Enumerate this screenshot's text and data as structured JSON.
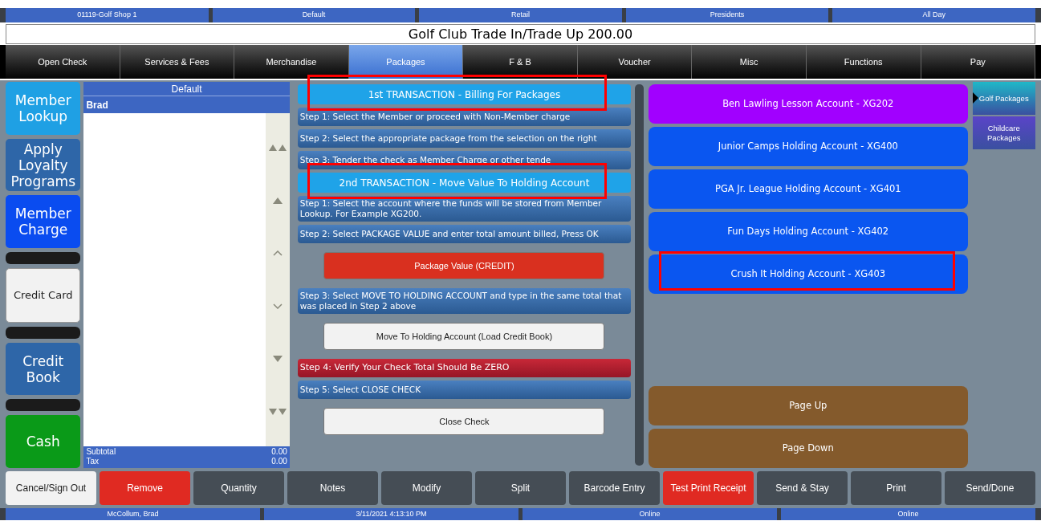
{
  "header_fields": [
    "01119-Golf Shop 1",
    "Default",
    "Retail",
    "Presidents",
    "All Day"
  ],
  "title": "Golf Club Trade In/Trade Up 200.00",
  "tabs": [
    {
      "label": "Open Check",
      "selected": false
    },
    {
      "label": "Services & Fees",
      "selected": false
    },
    {
      "label": "Merchandise",
      "selected": false
    },
    {
      "label": "Packages",
      "selected": true
    },
    {
      "label": "F & B",
      "selected": false
    },
    {
      "label": "Voucher",
      "selected": false
    },
    {
      "label": "Misc",
      "selected": false
    },
    {
      "label": "Functions",
      "selected": false
    },
    {
      "label": "Pay",
      "selected": false
    }
  ],
  "tender_buttons": [
    {
      "kind": "button",
      "label": "Member Lookup",
      "color": "#1fa0e4"
    },
    {
      "kind": "button",
      "label": "Apply Loyalty Programs",
      "color": "#2e66a8"
    },
    {
      "kind": "button",
      "label": "Member Charge",
      "color": "#0a4cf0"
    },
    {
      "kind": "blank"
    },
    {
      "kind": "button",
      "label": "Credit Card",
      "color": "#f2f2f2"
    },
    {
      "kind": "blank"
    },
    {
      "kind": "button",
      "label": "Credit Book",
      "color": "#2e66a8"
    },
    {
      "kind": "blank"
    },
    {
      "kind": "button",
      "label": "Cash",
      "color": "#0a9a18"
    }
  ],
  "check": {
    "header": "Default",
    "member": "Brad",
    "subtotal_label": "Subtotal",
    "subtotal": "0.00",
    "tax_label": "Tax",
    "tax": "0.00"
  },
  "instructions": [
    {
      "kind": "heading",
      "text": "1st TRANSACTION - Billing For Packages",
      "annotated": true
    },
    {
      "kind": "step",
      "text": "Step 1:  Select the Member or proceed with Non-Member charge"
    },
    {
      "kind": "step",
      "text": "Step 2:  Select the appropriate package from the selection on the right"
    },
    {
      "kind": "step",
      "text": "Step 3:  Tender the check as Member Charge or other tende"
    },
    {
      "kind": "heading",
      "text": "2nd TRANSACTION - Move Value To Holding Account",
      "annotated": true
    },
    {
      "kind": "step",
      "text": "Step 1:  Select the account where the funds will be stored from Member Lookup. For Example XG200."
    },
    {
      "kind": "step",
      "text": "Step 2:  Select PACKAGE VALUE and enter total amount billed, Press OK"
    },
    {
      "kind": "button",
      "text": "Package Value (CREDIT)",
      "color": "#d9301f"
    },
    {
      "kind": "step",
      "text": "Step 3:  Select MOVE TO HOLDING ACCOUNT and type in the same total that was placed in Step 2 above"
    },
    {
      "kind": "button",
      "text": "Move To Holding Account (Load Credit Book)",
      "color": "#f2f2f2"
    },
    {
      "kind": "alert",
      "text": "Step 4:  Verify Your Check Total Should Be ZERO"
    },
    {
      "kind": "step",
      "text": "Step 5:  Select CLOSE CHECK"
    },
    {
      "kind": "button",
      "text": "Close Check",
      "color": "#f2f2f2"
    }
  ],
  "accounts": [
    {
      "label": "Ben Lawling Lesson Account - XG202",
      "color": "#a100ff",
      "annotated": false
    },
    {
      "label": "Junior Camps Holding Account - XG400",
      "color": "#0a56f0",
      "annotated": false
    },
    {
      "label": "PGA Jr. League Holding Account - XG401",
      "color": "#0a56f0",
      "annotated": false
    },
    {
      "label": "Fun Days Holding Account - XG402",
      "color": "#0a56f0",
      "annotated": false
    },
    {
      "label": "Crush It Holding Account - XG403",
      "color": "#0a56f0",
      "annotated": true
    }
  ],
  "paging": [
    "Page Up",
    "Page Down"
  ],
  "categories": [
    {
      "label": "Golf Packages",
      "selected": true,
      "color": "#1fb8c8"
    },
    {
      "label": "Childcare Packages",
      "selected": false,
      "color": "#5a44c8"
    }
  ],
  "bottom_buttons": [
    {
      "label": "Cancel/Sign Out",
      "color": "#f2f2f2"
    },
    {
      "label": "Remove",
      "color": "#e02a22"
    },
    {
      "label": "Quantity",
      "color": "#454d55"
    },
    {
      "label": "Notes",
      "color": "#454d55"
    },
    {
      "label": "Modify",
      "color": "#454d55"
    },
    {
      "label": "Split",
      "color": "#454d55"
    },
    {
      "label": "Barcode Entry",
      "color": "#454d55"
    },
    {
      "label": "Test Print Receipt",
      "color": "#e02a22"
    },
    {
      "label": "Send & Stay",
      "color": "#454d55"
    },
    {
      "label": "Print",
      "color": "#454d55"
    },
    {
      "label": "Send/Done",
      "color": "#454d55"
    }
  ],
  "status_bar": [
    "McCollum, Brad",
    "3/11/2021 4:13:10 PM",
    "Online",
    "Online"
  ]
}
